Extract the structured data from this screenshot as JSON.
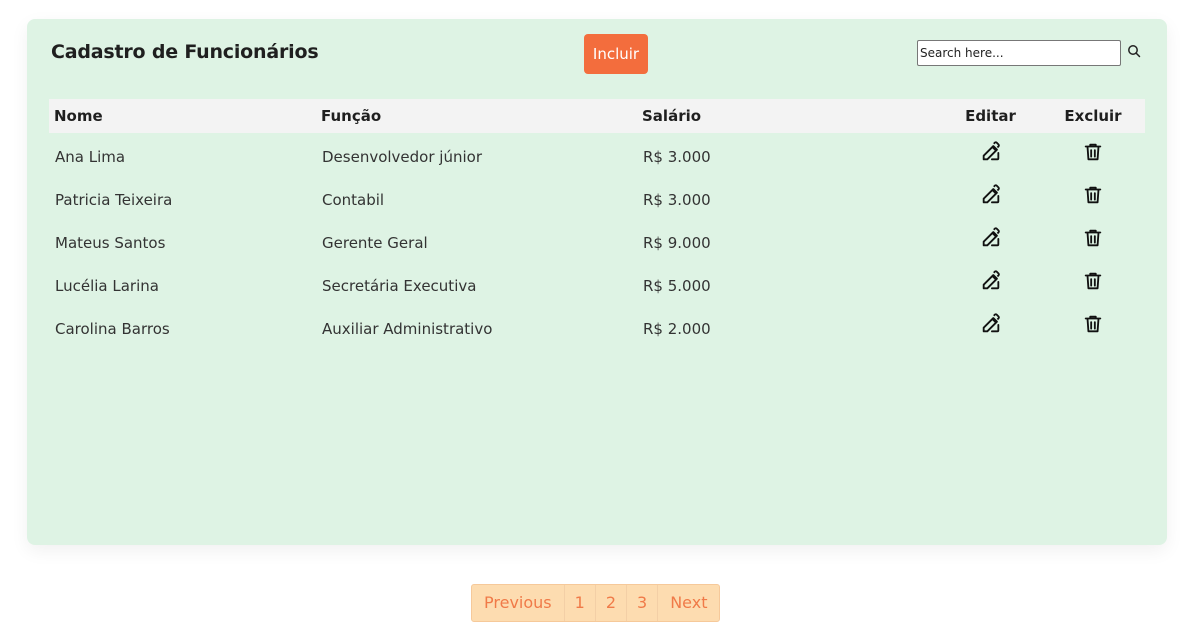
{
  "header": {
    "title": "Cadastro de Funcionários",
    "add_label": "Incluir",
    "search_placeholder": "Search here..."
  },
  "table": {
    "columns": [
      "Nome",
      "Função",
      "Salário",
      "Editar",
      "Excluir"
    ],
    "rows": [
      {
        "nome": "Ana Lima",
        "funcao": "Desenvolvedor júnior",
        "salario": "R$ 3.000"
      },
      {
        "nome": "Patricia Teixeira",
        "funcao": "Contabil",
        "salario": "R$ 3.000"
      },
      {
        "nome": "Mateus Santos",
        "funcao": "Gerente Geral",
        "salario": "R$ 9.000"
      },
      {
        "nome": "Lucélia Larina",
        "funcao": "Secretária Executiva",
        "salario": "R$ 5.000"
      },
      {
        "nome": "Carolina Barros",
        "funcao": "Auxiliar Administrativo",
        "salario": "R$ 2.000"
      }
    ]
  },
  "pagination": {
    "previous_label": "Previous",
    "pages": [
      "1",
      "2",
      "3"
    ],
    "next_label": "Next"
  },
  "colors": {
    "panel_bg": "#def3e4",
    "accent": "#f36d3d",
    "pagination_bg": "#fddcb0",
    "pagination_text": "#f07a48"
  },
  "icons": {
    "edit": "edit-icon",
    "delete": "trash-icon",
    "search": "search-icon"
  }
}
